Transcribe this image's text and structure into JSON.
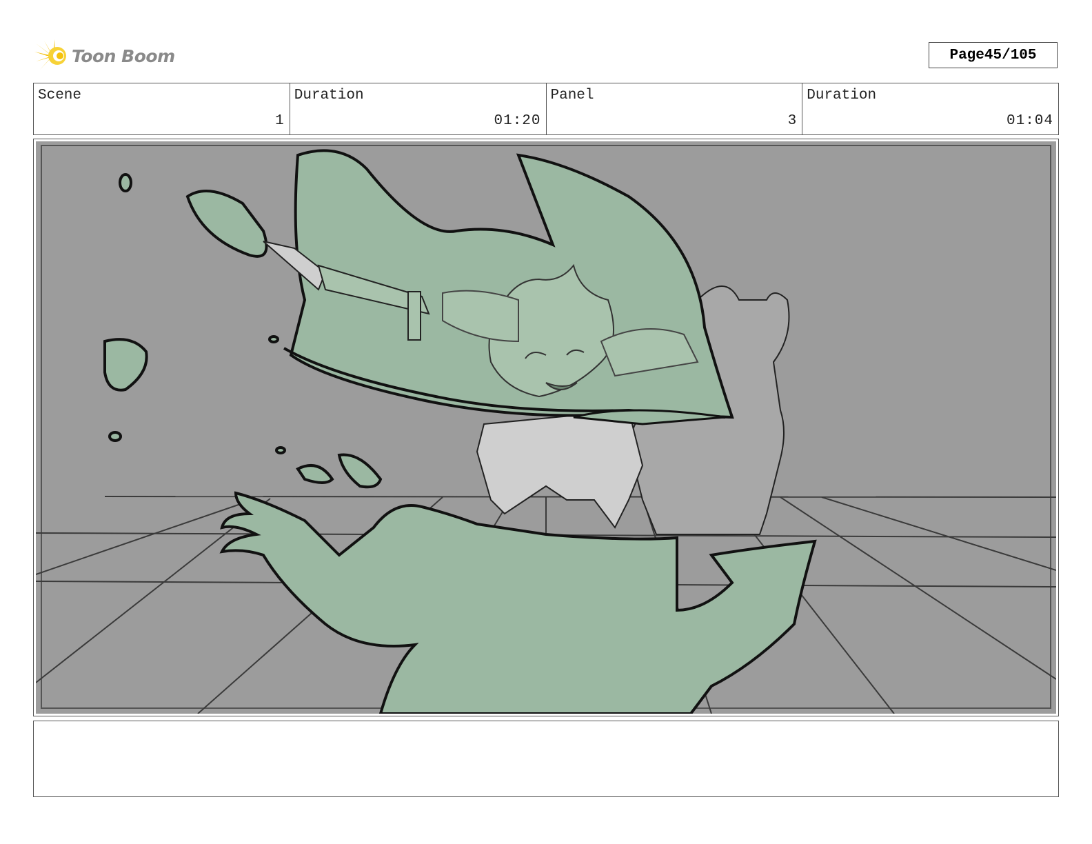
{
  "header": {
    "logo_text": "Toon Boom",
    "logo_icon": "starburst-logo-icon",
    "page_label": "Page",
    "page_number": "45/105"
  },
  "info": {
    "scene_label": "Scene",
    "scene_value": "1",
    "scene_duration_label": "Duration",
    "scene_duration_value": "01:20",
    "panel_label": "Panel",
    "panel_value": "3",
    "panel_duration_label": "Duration",
    "panel_duration_value": "01:04"
  },
  "panel": {
    "image_description": "storyboard-sketch",
    "colors": {
      "background": "#9c9c9c",
      "effect_fill": "#9bb8a2",
      "character_fill": "#cfcfcf"
    }
  },
  "notes": {
    "text": ""
  }
}
